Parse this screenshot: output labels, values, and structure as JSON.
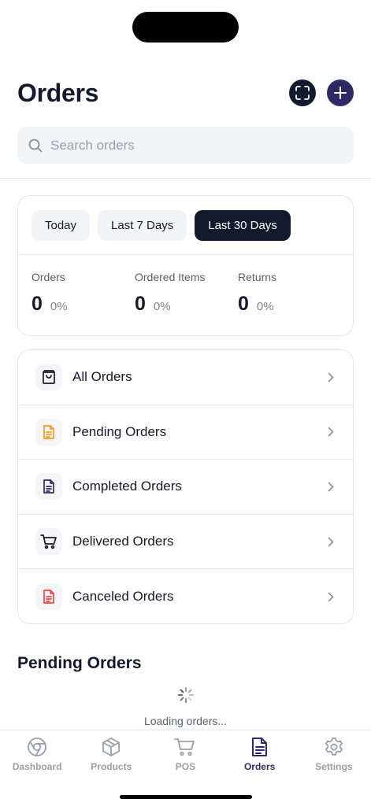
{
  "header": {
    "title": "Orders",
    "scan_icon": "scan-icon",
    "add_icon": "plus-icon"
  },
  "search": {
    "placeholder": "Search orders"
  },
  "period_tabs": [
    {
      "label": "Today",
      "active": false
    },
    {
      "label": "Last 7 Days",
      "active": false
    },
    {
      "label": "Last 30 Days",
      "active": true
    }
  ],
  "stats": [
    {
      "label": "Orders",
      "value": "0",
      "change": "0%"
    },
    {
      "label": "Ordered Items",
      "value": "0",
      "change": "0%"
    },
    {
      "label": "Returns",
      "value": "0",
      "change": "0%"
    }
  ],
  "order_links": [
    {
      "label": "All Orders",
      "icon": "shopping-bag-icon",
      "color": "#141a2e"
    },
    {
      "label": "Pending Orders",
      "icon": "document-icon",
      "color": "#f0a020"
    },
    {
      "label": "Completed Orders",
      "icon": "document-icon",
      "color": "#2e2a66"
    },
    {
      "label": "Delivered Orders",
      "icon": "cart-icon",
      "color": "#141a2e"
    },
    {
      "label": "Canceled Orders",
      "icon": "document-icon",
      "color": "#e5484d"
    }
  ],
  "pending_section": {
    "title": "Pending Orders",
    "loading_text": "Loading orders..."
  },
  "tabbar": [
    {
      "label": "Dashboard",
      "icon": "chrome-icon",
      "active": false
    },
    {
      "label": "Products",
      "icon": "box-icon",
      "active": false
    },
    {
      "label": "POS",
      "icon": "cart-icon",
      "active": false
    },
    {
      "label": "Orders",
      "icon": "document-icon",
      "active": true
    },
    {
      "label": "Settings",
      "icon": "gear-icon",
      "active": false
    }
  ],
  "colors": {
    "primary": "#141a2e",
    "accent": "#2e2a66",
    "muted": "#9a9eaa"
  }
}
